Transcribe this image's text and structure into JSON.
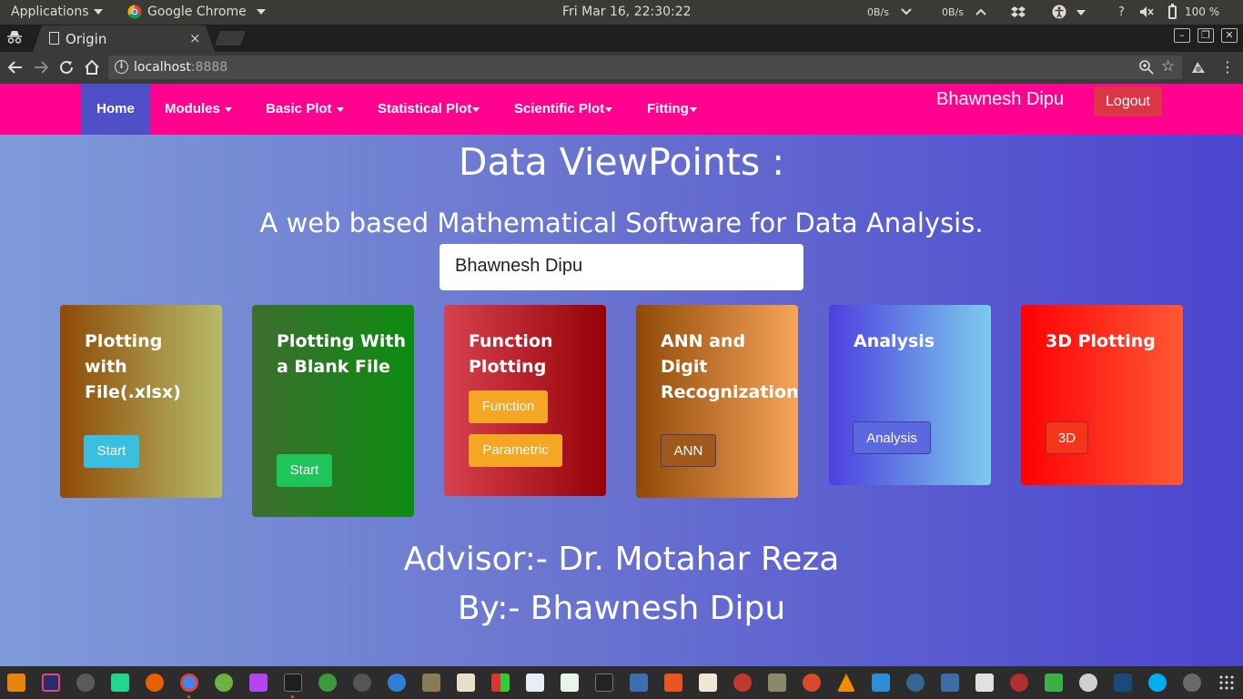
{
  "desktop": {
    "applications_label": "Applications",
    "active_app_label": "Google Chrome",
    "clock": "Fri Mar 16, 22:30:22",
    "net_down": "0B/s",
    "net_up": "0B/s",
    "help": "?",
    "battery_text": "100 %"
  },
  "browser": {
    "tab_title": "Origin",
    "tab_close": "×",
    "url_host": "localhost",
    "url_port": ":8888",
    "window_minimize": "–",
    "window_restore": "❐",
    "window_close": "✕"
  },
  "navbar": {
    "items": [
      {
        "label": "Home",
        "dropdown": false
      },
      {
        "label": "Modules",
        "dropdown": true
      },
      {
        "label": "Basic Plot",
        "dropdown": true
      },
      {
        "label": "Statistical Plot",
        "dropdown": true
      },
      {
        "label": "Scientific Plot",
        "dropdown": true
      },
      {
        "label": "Fitting",
        "dropdown": true
      }
    ],
    "user_name": "Bhawnesh Dipu",
    "logout_label": "Logout",
    "background": "#ff0390",
    "active_color": "#4f4fc8"
  },
  "hero": {
    "title": "Data ViewPoints :",
    "subtitle": "A web based Mathematical Software for Data Analysis.",
    "name_box": "Bhawnesh Dipu"
  },
  "cards": [
    {
      "title": "Plotting with File(.xlsx)",
      "buttons": [
        {
          "label": "Start",
          "color": "#3bbfe0"
        }
      ]
    },
    {
      "title": "Plotting With a Blank File",
      "buttons": [
        {
          "label": "Start",
          "color": "#1fc45b"
        }
      ]
    },
    {
      "title": "Function Plotting",
      "buttons": [
        {
          "label": "Function",
          "color": "#f5a623"
        },
        {
          "label": "Parametric",
          "color": "#f5a623"
        }
      ]
    },
    {
      "title": "ANN and Digit Recognization",
      "buttons": [
        {
          "label": "ANN",
          "color": "#a0591a"
        }
      ]
    },
    {
      "title": "Analysis",
      "buttons": [
        {
          "label": "Analysis",
          "color": "#5b68e0"
        }
      ]
    },
    {
      "title": "3D Plotting",
      "buttons": [
        {
          "label": "3D",
          "color": "#f5341a"
        }
      ]
    }
  ],
  "footer": {
    "advisor": "Advisor:- Dr. Motahar Reza",
    "author": "By:- Bhawnesh Dipu"
  }
}
